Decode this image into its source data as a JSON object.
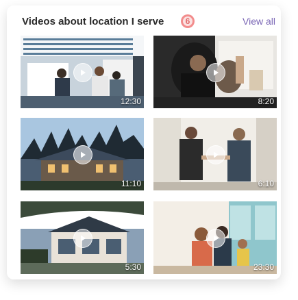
{
  "header": {
    "title": "Videos about location I serve",
    "count": "6",
    "view_all": "View all"
  },
  "videos": [
    {
      "duration": "12:30"
    },
    {
      "duration": "8:20"
    },
    {
      "duration": "11:10"
    },
    {
      "duration": "6:10"
    },
    {
      "duration": "5:30"
    },
    {
      "duration": "23:30"
    }
  ],
  "icons": {
    "play": "play-icon"
  }
}
